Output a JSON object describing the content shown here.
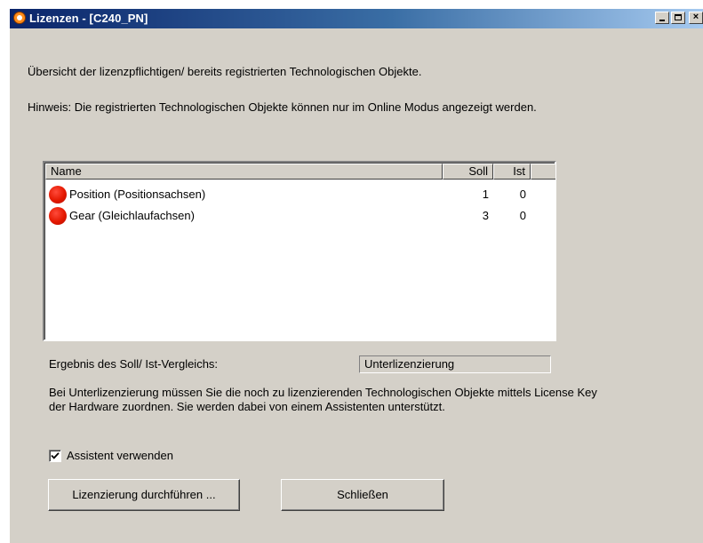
{
  "window": {
    "title": "Lizenzen - [C240_PN]",
    "controls": {
      "minimize": "minimize",
      "maximize": "maximize",
      "close": "×"
    }
  },
  "intro_text": "Übersicht der lizenzpflichtigen/ bereits registrierten Technologischen Objekte.",
  "hint_text": "Hinweis: Die registrierten Technologischen Objekte können nur im Online Modus angezeigt werden.",
  "table": {
    "columns": {
      "name": "Name",
      "soll": "Soll",
      "ist": "Ist"
    },
    "rows": [
      {
        "status": "red",
        "name": "Position (Positionsachsen)",
        "soll": "1",
        "ist": "0"
      },
      {
        "status": "red",
        "name": "Gear (Gleichlaufachsen)",
        "soll": "3",
        "ist": "0"
      }
    ]
  },
  "result": {
    "label": "Ergebnis des Soll/ Ist-Vergleichs:",
    "value": "Unterlizenzierung"
  },
  "explanation": "Bei Unterlizenzierung müssen Sie die noch zu lizenzierenden Technologischen Objekte mittels License Key der Hardware zuordnen. Sie werden dabei von einem Assistenten unterstützt.",
  "assistant_checkbox": {
    "label": "Assistent verwenden",
    "checked": true
  },
  "buttons": {
    "license": "Lizenzierung durchführen ...",
    "close": "Schließen"
  },
  "colors": {
    "title_gradient_start": "#0a246a",
    "title_gradient_end": "#a6caf0",
    "dialog_bg": "#d4d0c8",
    "status_red": "#e41800"
  }
}
